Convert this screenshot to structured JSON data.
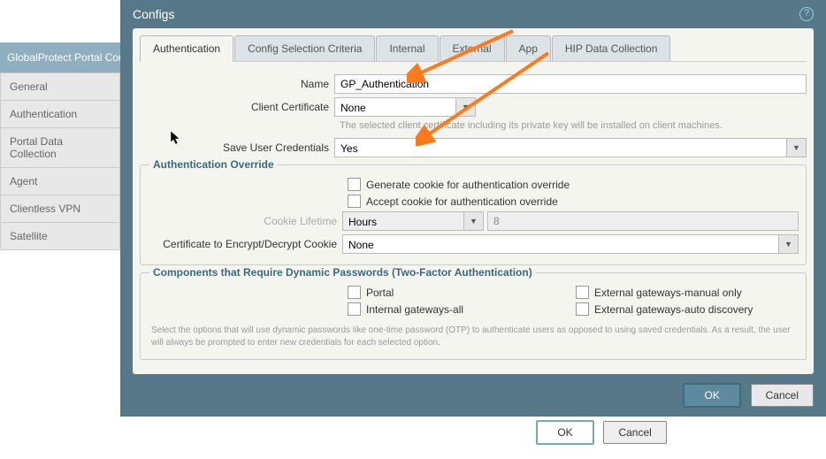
{
  "sidebar": {
    "header": "GlobalProtect Portal Con",
    "items": [
      "General",
      "Authentication",
      "Portal Data Collection",
      "Agent",
      "Clientless VPN",
      "Satellite"
    ]
  },
  "dialog": {
    "title": "Configs",
    "help": "?",
    "tabs": [
      "Authentication",
      "Config Selection Criteria",
      "Internal",
      "External",
      "App",
      "HIP Data Collection"
    ],
    "active_tab": 0,
    "name_label": "Name",
    "name_value": "GP_Authentication",
    "client_cert_label": "Client Certificate",
    "client_cert_value": "None",
    "client_cert_hint": "The selected client certificate including its private key will be installed on client machines.",
    "save_creds_label": "Save User Credentials",
    "save_creds_value": "Yes",
    "auth_override": {
      "legend": "Authentication Override",
      "gen_cookie": "Generate cookie for authentication override",
      "accept_cookie": "Accept cookie for authentication override",
      "cookie_lifetime_label": "Cookie Lifetime",
      "cookie_lifetime_unit": "Hours",
      "cookie_lifetime_value": "8",
      "encrypt_label": "Certificate to Encrypt/Decrypt Cookie",
      "encrypt_value": "None"
    },
    "dyn_pw": {
      "legend": "Components that Require Dynamic Passwords (Two-Factor Authentication)",
      "portal": "Portal",
      "ext_manual": "External gateways-manual only",
      "int_all": "Internal gateways-all",
      "ext_auto": "External gateways-auto discovery",
      "note": "Select the options that will use dynamic passwords like one-time password (OTP) to authenticate users as opposed to using saved credentials. As a result, the user will always be prompted to enter new credentials for each selected option."
    },
    "ok": "OK",
    "cancel": "Cancel"
  },
  "outer": {
    "ok": "OK",
    "cancel": "Cancel"
  }
}
